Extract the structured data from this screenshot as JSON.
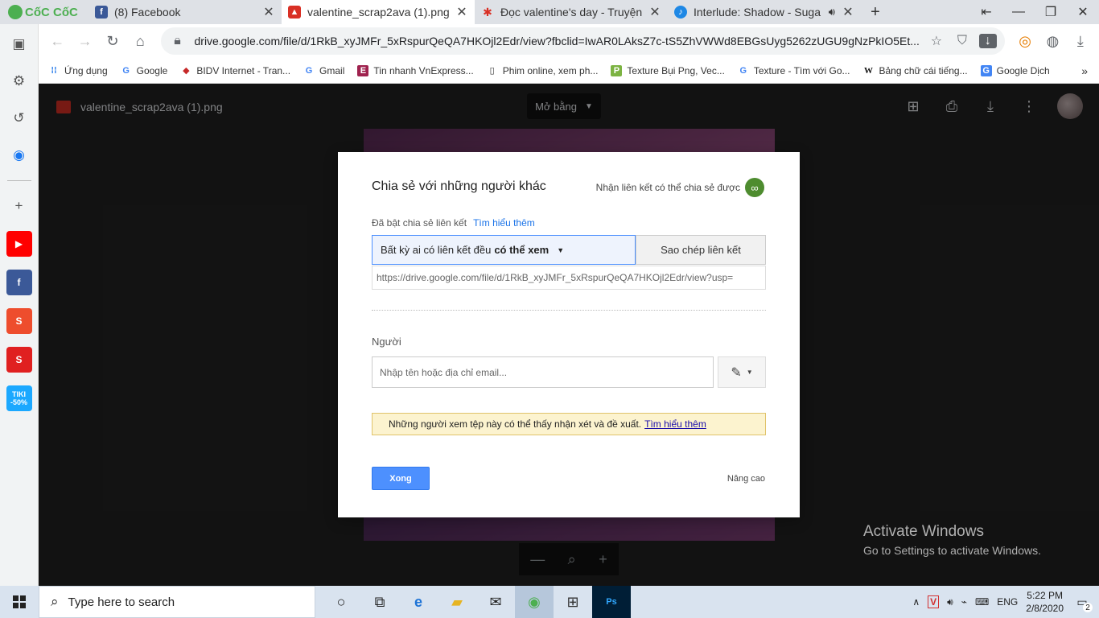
{
  "browser": {
    "brand": "CốC CốC",
    "tabs": [
      {
        "title": "(8) Facebook",
        "favicon": "facebook-icon",
        "active": false
      },
      {
        "title": "valentine_scrap2ava (1).png -",
        "favicon": "drive-image-icon",
        "active": true
      },
      {
        "title": "Đọc valentine's day - Truyện T",
        "favicon": "maple-leaf-icon",
        "active": false
      },
      {
        "title": "Interlude: Shadow - Suga",
        "favicon": "music-icon",
        "active": false
      }
    ],
    "url": "drive.google.com/file/d/1RkB_xyJMFr_5xRspurQeQA7HKOjl2Edr/view?fbclid=IwAR0LAksZ7c-tS5ZhVWWd8EBGsUyg5262zUGU9gNzPkIO5Et...",
    "bookmarks": [
      {
        "label": "Ứng dụng",
        "icon": "apps-grid-icon"
      },
      {
        "label": "Google",
        "icon": "google-icon"
      },
      {
        "label": "BIDV Internet - Tran...",
        "icon": "bidv-icon"
      },
      {
        "label": "Gmail",
        "icon": "google-icon"
      },
      {
        "label": "Tin nhanh VnExpress...",
        "icon": "vnexpress-icon"
      },
      {
        "label": "Phim online, xem ph...",
        "icon": "document-icon"
      },
      {
        "label": "Texture Bụi Png, Vec...",
        "icon": "pngtree-icon"
      },
      {
        "label": "Texture - Tìm với Go...",
        "icon": "google-icon"
      },
      {
        "label": "Bảng chữ cái tiếng...",
        "icon": "wikipedia-icon"
      },
      {
        "label": "Google Dịch",
        "icon": "translate-icon"
      }
    ]
  },
  "sidebar": {
    "apps": [
      {
        "name": "youtube",
        "color": "#ff0000",
        "label": "▶"
      },
      {
        "name": "facebook",
        "color": "#3b5998",
        "label": "f"
      },
      {
        "name": "shopee",
        "color": "#ee4d2d",
        "label": "S"
      },
      {
        "name": "sendo",
        "color": "#e02020",
        "label": "S"
      },
      {
        "name": "tiki",
        "color": "#1ba8ff",
        "label": "TIKI -50%"
      }
    ]
  },
  "viewer": {
    "file_name": "valentine_scrap2ava (1).png",
    "open_with": "Mở bằng"
  },
  "dialog": {
    "title": "Chia sẻ với những người khác",
    "get_link": "Nhận liên kết có thể chia sẻ được",
    "link_sharing_on": "Đã bật chia sẻ liên kết",
    "learn_more": "Tìm hiểu thêm",
    "permission_prefix": "Bất kỳ ai có liên kết đều",
    "permission_bold": "có thể xem",
    "copy_link": "Sao chép liên kết",
    "share_url": "https://drive.google.com/file/d/1RkB_xyJMFr_5xRspurQeQA7HKOjl2Edr/view?usp=",
    "people_label": "Người",
    "email_placeholder": "Nhập tên hoặc địa chỉ email...",
    "notice_text": "Những người xem tệp này có thể thấy nhận xét và đề xuất.",
    "notice_link": "Tìm hiểu thêm",
    "done": "Xong",
    "advanced": "Nâng cao"
  },
  "watermark": {
    "line1": "Activate Windows",
    "line2": "Go to Settings to activate Windows."
  },
  "taskbar": {
    "search_placeholder": "Type here to search",
    "language": "ENG",
    "time": "5:22 PM",
    "date": "2/8/2020",
    "notifications": "2"
  },
  "colors": {
    "accent_blue": "#4d90fe",
    "notice_bg": "#fcf3cf",
    "link_green": "#4e8c2f"
  }
}
